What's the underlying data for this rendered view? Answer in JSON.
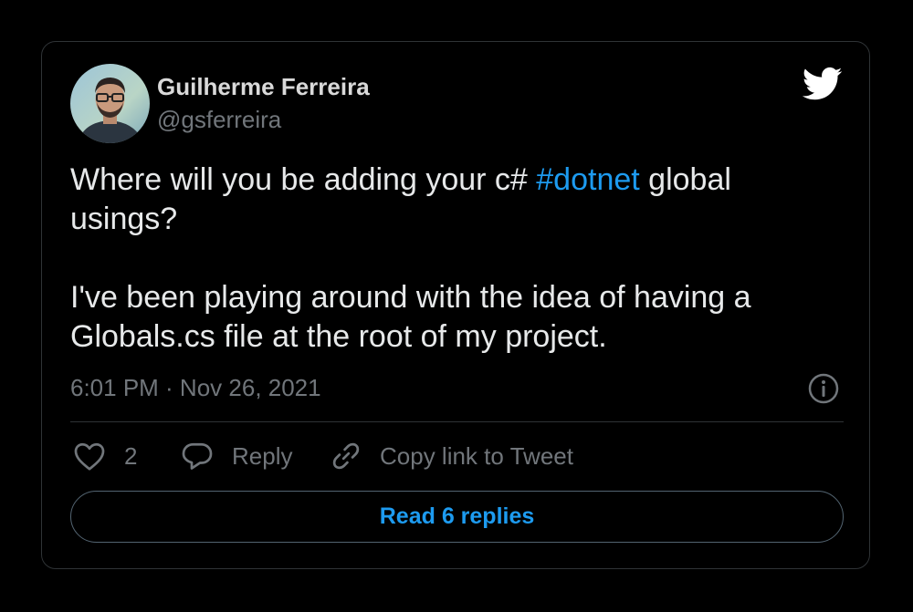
{
  "author": {
    "name": "Guilherme Ferreira",
    "handle": "@gsferreira",
    "avatar_icon": "avatar-photo"
  },
  "brand": {
    "icon": "twitter-bird-icon",
    "color": "#1d9bf0"
  },
  "tweet": {
    "text_before": "Where will you be adding your c# ",
    "hashtag": "#dotnet",
    "text_after": " global usings?",
    "paragraph2": "I've been playing around with the idea of having a Globals.cs file at the root of my project."
  },
  "meta": {
    "timestamp": "6:01 PM · Nov 26, 2021",
    "info_icon": "info-icon"
  },
  "actions": {
    "like_icon": "heart-icon",
    "like_count": "2",
    "reply_icon": "speech-bubble-icon",
    "reply_label": "Reply",
    "copy_icon": "link-icon",
    "copy_label": "Copy link to Tweet"
  },
  "read_button": {
    "label": "Read 6 replies"
  },
  "colors": {
    "background": "#000000",
    "text": "#e7e9ea",
    "secondary": "#71767b",
    "accent": "#1d9bf0",
    "border": "#2f3336"
  }
}
